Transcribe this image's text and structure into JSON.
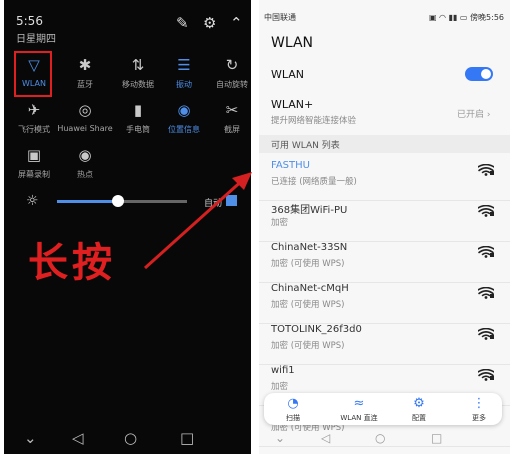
{
  "left_panel": {
    "time": "5:56",
    "date": "日星期四",
    "header_icons": [
      "edit-icon",
      "gear-icon",
      "chevron-up-icon"
    ],
    "tiles": [
      {
        "label": "WLAN",
        "icon": "wifi-icon",
        "active": true,
        "glyph": "▽"
      },
      {
        "label": "蓝牙",
        "icon": "bluetooth-icon",
        "active": false,
        "glyph": "✱"
      },
      {
        "label": "移动数据",
        "icon": "mobile-data-icon",
        "active": false,
        "glyph": "⇅"
      },
      {
        "label": "振动",
        "icon": "vibrate-icon",
        "active": true,
        "glyph": "☰"
      },
      {
        "label": "自动旋转",
        "icon": "rotate-icon",
        "active": false,
        "glyph": "↻"
      },
      {
        "label": "飞行模式",
        "icon": "airplane-icon",
        "active": false,
        "glyph": "✈"
      },
      {
        "label": "Huawei Share",
        "icon": "share-icon",
        "active": false,
        "glyph": "◎"
      },
      {
        "label": "手电筒",
        "icon": "flashlight-icon",
        "active": false,
        "glyph": "▮"
      },
      {
        "label": "位置信息",
        "icon": "location-icon",
        "active": true,
        "glyph": "◉"
      },
      {
        "label": "截屏",
        "icon": "screenshot-icon",
        "active": false,
        "glyph": "✂"
      },
      {
        "label": "屏幕录制",
        "icon": "screen-record-icon",
        "active": false,
        "glyph": "▣"
      },
      {
        "label": "热点",
        "icon": "hotspot-icon",
        "active": false,
        "glyph": "◉"
      }
    ],
    "brightness_level": 0.47,
    "auto_label": "自动",
    "annotation": "长按",
    "arrow_color": "#d42020"
  },
  "right_panel": {
    "carrier": "中国联通",
    "status_right": "傍晚5:56",
    "title": "WLAN",
    "wlan_label": "WLAN",
    "wlan_on": true,
    "wlanplus_label": "WLAN+",
    "wlanplus_sub": "提升网络智能连接体验",
    "wlanplus_status": "已开启",
    "section_title": "可用 WLAN 列表",
    "networks": [
      {
        "name": "FASTHU",
        "status": "已连接 (网络质量一般)",
        "connected": true
      },
      {
        "name": "368集团WiFi-PU",
        "status": "加密",
        "connected": false
      },
      {
        "name": "ChinaNet-33SN",
        "status": "加密 (可使用 WPS)",
        "connected": false
      },
      {
        "name": "ChinaNet-cMqH",
        "status": "加密 (可使用 WPS)",
        "connected": false
      },
      {
        "name": "TOTOLINK_26f3d0",
        "status": "加密 (可使用 WPS)",
        "connected": false
      },
      {
        "name": "wifi1",
        "status": "加密",
        "connected": false
      },
      {
        "name": "",
        "status": "加密 (可使用 WPS)",
        "connected": false
      }
    ],
    "bottom_actions": [
      {
        "label": "扫描",
        "icon": "scan-icon",
        "glyph": "◔"
      },
      {
        "label": "WLAN 直连",
        "icon": "wlan-direct-icon",
        "glyph": "≈"
      },
      {
        "label": "配置",
        "icon": "config-icon",
        "glyph": "⚙"
      },
      {
        "label": "更多",
        "icon": "more-icon",
        "glyph": "⋮"
      }
    ]
  },
  "colors": {
    "accent": "#3478f6",
    "annotation_red": "#e02020"
  }
}
